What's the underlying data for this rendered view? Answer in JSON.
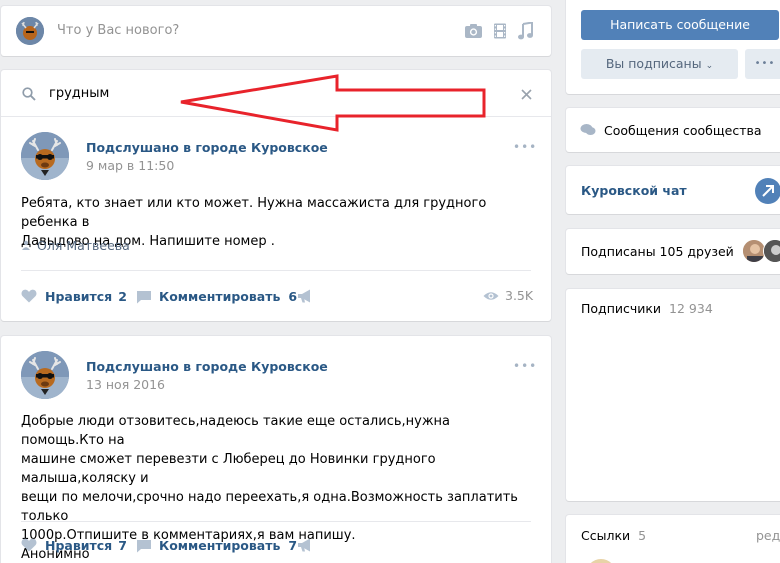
{
  "composer": {
    "placeholder": "Что у Вас нового?"
  },
  "search": {
    "query": "грудным"
  },
  "posts": [
    {
      "author": "Подслушано в городе Куровское",
      "date": "9 мар в 11:50",
      "text_lines": [
        "Ребята, кто знает или кто может. Нужна массажиста для грудного ребенка в",
        "Давыдово на дом. Напишите номер ."
      ],
      "signer": "Оля Матвеева",
      "like_label": "Нравится",
      "likes": "2",
      "comment_label": "Комментировать",
      "comments": "6",
      "views": "3.5K"
    },
    {
      "author": "Подслушано в городе Куровское",
      "date": "13 ноя 2016",
      "text_lines": [
        "Добрые люди отзовитесь,надеюсь такие еще остались,нужна помощь.Кто на",
        "машине сможет перевезти с Люберец до Новинки грудного малыша,коляску и",
        "вещи по мелочи,срочно надо переехать,я одна.Возможность заплатить только",
        "1000р.Отпишите в комментариях,я вам напишу.",
        "Анонимно"
      ],
      "like_label": "Нравится",
      "likes": "7",
      "comment_label": "Комментировать",
      "comments": "7"
    }
  ],
  "sidebar": {
    "write_message": "Написать сообщение",
    "subscribed": "Вы подписаны",
    "more": "•••",
    "community_messages": "Сообщения сообщества",
    "chat_name": "Куровской чат",
    "friends_subscribed": "Подписаны 105 друзей",
    "followers_label": "Подписчики",
    "followers_count": "12 934",
    "links_label": "Ссылки",
    "links_count": "5",
    "edit_label": "ред."
  },
  "colors": {
    "accent": "#5181b8",
    "link": "#2a5885",
    "arrow": "#e8232b",
    "bg": "#edeef0"
  }
}
